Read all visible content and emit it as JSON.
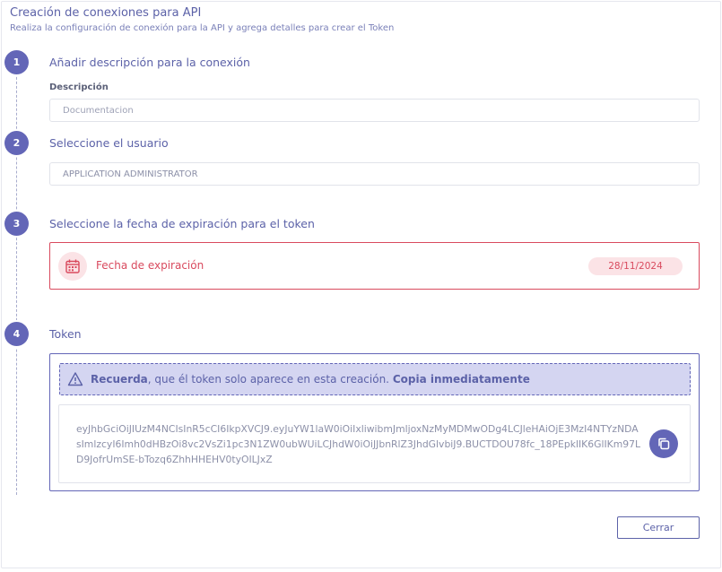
{
  "dialog": {
    "title": "Creación de conexiones para API",
    "subtitle": "Realiza la configuración de conexión para la API y agrega detalles para crear el Token"
  },
  "steps": [
    {
      "number": "1",
      "title": "Añadir descripción para la conexión",
      "field_label": "Descripción",
      "input_placeholder": "Documentacion"
    },
    {
      "number": "2",
      "title": "Seleccione el usuario",
      "selected_value": "APPLICATION ADMINISTRATOR"
    },
    {
      "number": "3",
      "title": "Seleccione la fecha de expiración para el token",
      "expiry_label": "Fecha de expiración",
      "expiry_date": "28/11/2024",
      "icon": "calendar-icon"
    },
    {
      "number": "4",
      "title": "Token",
      "warning": {
        "icon": "warning-icon",
        "bold_start": "Recuerda",
        "middle": ", que él token solo aparece en esta creación.",
        "bold_end": "Copia inmediatamente"
      },
      "token": "eyJhbGciOiJIUzM4NCIsInR5cCI6IkpXVCJ9.eyJuYW1laW0iOiIxliwibmJmljoxNzMyMDMwODg4LCJleHAiOjE3MzI4NTYzNDAsImlzcyI6Imh0dHBzOi8vc2VsZi1pc3N1ZW0ubWUiLCJhdW0iOiJJbnRlZ3JhdGlvbiJ9.BUCTDOU78fc_18PEpklIK6GlIKm97LD9JofrUmSE-bTozq6ZhhHHEHV0tyOILJxZ",
      "copy_icon": "copy-icon"
    }
  ],
  "footer": {
    "close_label": "Cerrar"
  },
  "colors": {
    "primary": "#6366b7",
    "danger": "#d94a5e",
    "danger_light": "#fbe3e6",
    "warning_bg": "#d4d5f1"
  }
}
